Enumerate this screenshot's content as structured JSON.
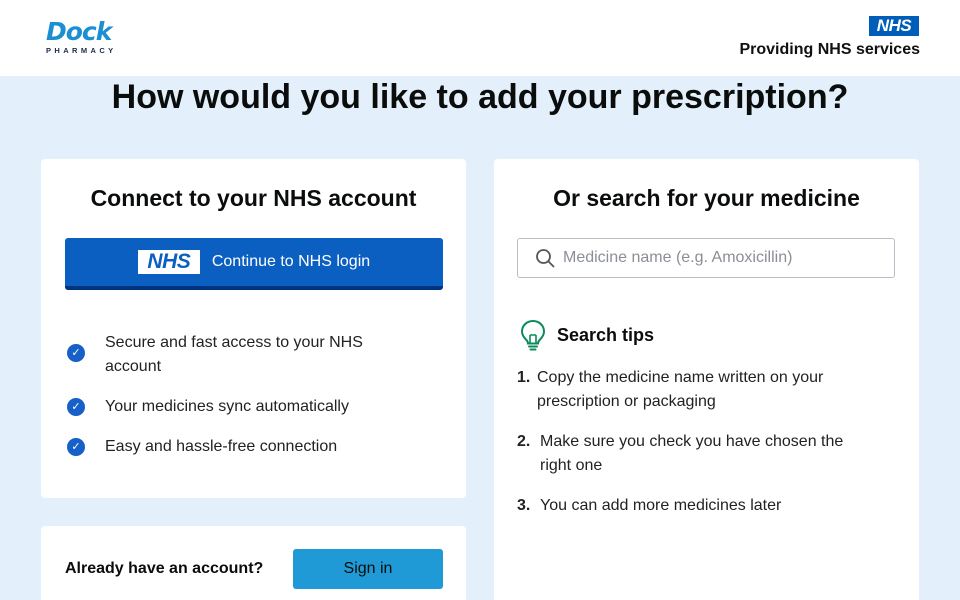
{
  "header": {
    "logo": {
      "word": "Dock",
      "sub": "PHARMACY"
    },
    "nhs_badge": "NHS",
    "nhs_services": "Providing NHS services"
  },
  "page_title": "How would you like to add your prescription?",
  "connect": {
    "title": "Connect to your NHS account",
    "button_logo": "NHS",
    "button_label": "Continue to NHS login",
    "benefits": [
      "Secure and fast access to your NHS account",
      "Your medicines sync automatically",
      "Easy and hassle-free connection"
    ]
  },
  "search": {
    "title": "Or search for your medicine",
    "placeholder": "Medicine name (e.g. Amoxicillin)",
    "value": "",
    "tips_title": "Search tips",
    "tips": [
      {
        "num": "1.",
        "text": "Copy the medicine name written on your prescription or packaging"
      },
      {
        "num": "2.",
        "text": "Make sure you check you have chosen the right one"
      },
      {
        "num": "3.",
        "text": "You can add more medicines later"
      }
    ]
  },
  "signin": {
    "label": "Already have an account?",
    "button": "Sign in"
  },
  "colors": {
    "background": "#e3effa",
    "nhs_blue": "#0b5fc1",
    "signin_blue": "#1f9ad6",
    "tips_icon_green": "#0c8a5a",
    "logo_blue": "#1b8fd2"
  }
}
